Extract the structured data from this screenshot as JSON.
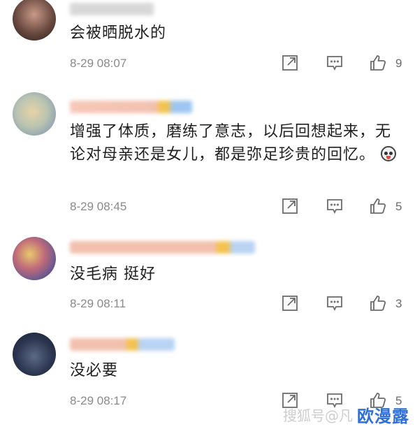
{
  "comments": [
    {
      "text": "会被晒脱水的",
      "time": "8-29 08:07",
      "likes": "9"
    },
    {
      "text": "增强了体质，磨练了意志，以后回想起来，无论对母亲还是女儿，都是弥足珍贵的回忆。",
      "time": "8-29 08:45",
      "likes": "5"
    },
    {
      "text": "没毛病 挺好",
      "time": "8-29 08:11",
      "likes": "3"
    },
    {
      "text": "没必要",
      "time": "8-29 08:17",
      "likes": "5"
    }
  ],
  "icons": {
    "share": "share-icon",
    "reply": "comment-icon",
    "like": "thumbs-up-icon"
  },
  "watermark": {
    "site": "搜狐号@凡",
    "brand": "欧漫露"
  },
  "colors": {
    "meta_text": "#8a8a8a",
    "icon": "#6b6b6b",
    "brand": "#2f6fd6"
  }
}
